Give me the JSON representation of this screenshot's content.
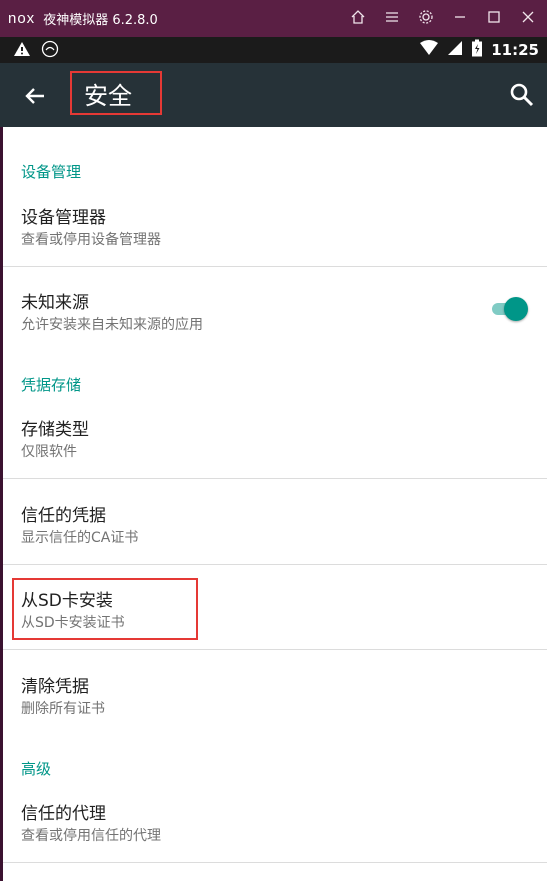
{
  "emulator": {
    "logo": "nox",
    "title": "夜神模拟器 6.2.8.0"
  },
  "status_bar": {
    "time": "11:25"
  },
  "action_bar": {
    "title": "安全"
  },
  "sections": {
    "device_admin": {
      "header": "设备管理",
      "items": [
        {
          "title": "设备管理器",
          "subtitle": "查看或停用设备管理器"
        },
        {
          "title": "未知来源",
          "subtitle": "允许安装来自未知来源的应用",
          "toggle_on": true
        }
      ]
    },
    "credential_storage": {
      "header": "凭据存储",
      "items": [
        {
          "title": "存储类型",
          "subtitle": "仅限软件"
        },
        {
          "title": "信任的凭据",
          "subtitle": "显示信任的CA证书"
        },
        {
          "title": "从SD卡安装",
          "subtitle": "从SD卡安装证书"
        },
        {
          "title": "清除凭据",
          "subtitle": "删除所有证书"
        }
      ]
    },
    "advanced": {
      "header": "高级",
      "items": [
        {
          "title": "信任的代理",
          "subtitle": "查看或停用信任的代理"
        }
      ]
    }
  },
  "colors": {
    "accent": "#009688",
    "action_bar": "#263238",
    "emulator_bar": "#5a1f44",
    "highlight": "#e53935"
  }
}
